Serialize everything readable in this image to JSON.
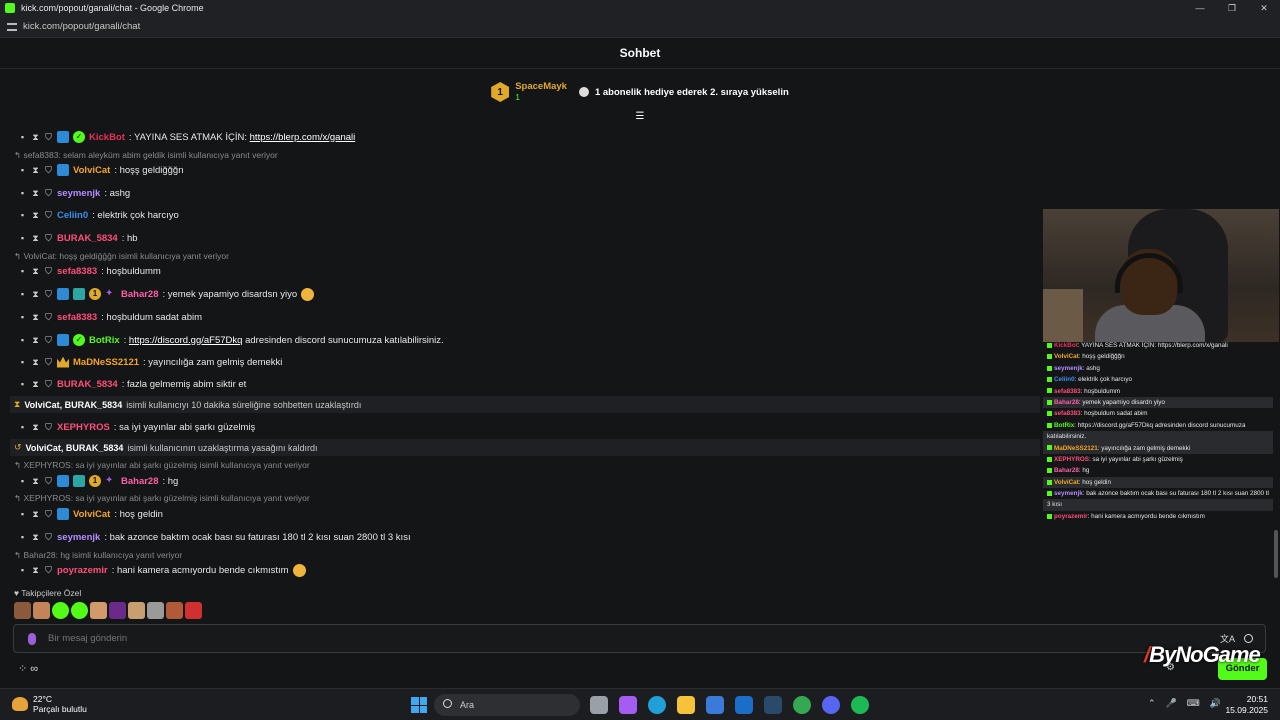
{
  "window": {
    "title": "kick.com/popout/ganali/chat - Google Chrome",
    "url": "kick.com/popout/ganali/chat"
  },
  "header": {
    "title": "Sohbet"
  },
  "pinned": {
    "rank": "1",
    "user": "SpaceMayk",
    "count": "1",
    "text": "1 abonelik hediye ederek 2. sıraya yükselin"
  },
  "messages": [
    {
      "user": "KickBot",
      "color": "#e8315a",
      "text": ": YAYINA SES ATMAK İÇİN: ",
      "link": "https://blerp.com/x/ganali"
    },
    {
      "reply": "sefa8383: selam aleyküm abim geldik isimli kullanıcıya yanıt veriyor",
      "user": "VolviCat",
      "color": "#f5a623",
      "text": ": hoşş geldiğğğn"
    },
    {
      "user": "seymenjk",
      "color": "#b68cff",
      "text": ": ashg"
    },
    {
      "user": "Celiin0",
      "color": "#3a8ef0",
      "text": ": elektrik çok harcıyo"
    },
    {
      "user": "BURAK_5834",
      "color": "#ff4f7a",
      "text": ": hb"
    },
    {
      "reply": "VolviCat: hoşş geldiğğğn isimli kullanıcıya yanıt veriyor",
      "user": "sefa8383",
      "color": "#ff4f7a",
      "text": ": hoşbuldumm"
    },
    {
      "user": "Bahar28",
      "color": "#ff5ea8",
      "text": ": yemek yapamiyo disardsn yiyo"
    },
    {
      "user": "sefa8383",
      "color": "#ff4f7a",
      "text": ": hoşbuldum sadat abim"
    },
    {
      "user": "BotRix",
      "color": "#53fc18",
      "text": " adresinden discord sunucumuza katılabilirsiniz.",
      "link": "https://discord.gg/aF57Dkq",
      "prefix": ": "
    },
    {
      "user": "MaDNeSS2121",
      "color": "#f5a623",
      "text": ": yayıncılığa zam gelmiş demekki"
    },
    {
      "user": "BURAK_5834",
      "color": "#ff4f7a",
      "text": ": fazla gelmemiş abim siktir et"
    },
    {
      "user": "XEPHYROS",
      "color": "#ff4f7a",
      "text": ": sa iyi yayınlar abi şarkı güzelmiş"
    },
    {
      "reply": "XEPHYROS: sa iyi yayınlar abi şarkı güzelmiş isimli kullanıcıya yanıt veriyor",
      "user": "Bahar28",
      "color": "#ff5ea8",
      "text": ": hg"
    },
    {
      "reply": "XEPHYROS: sa iyi yayınlar abi şarkı güzelmiş isimli kullanıcıya yanıt veriyor",
      "user": "VolviCat",
      "color": "#f5a623",
      "text": ": hoş geldin"
    },
    {
      "user": "seymenjk",
      "color": "#b68cff",
      "text": ": bak azonce baktım ocak bası su faturası 180 tl 2 kısı suan 2800 tl 3 kısı"
    },
    {
      "reply": "Bahar28: hg isimli kullanıcıya yanıt veriyor",
      "user": "poyrazemir",
      "color": "#ff4f7a",
      "text": ": hani kamera acmıyordu bende cıkmıstım"
    }
  ],
  "system": [
    {
      "names": "VolviCat, BURAK_5834",
      "text": "isimli kullanıcıyı 10 dakika süreliğine sohbetten uzaklaştırdı"
    },
    {
      "names": "VolviCat, BURAK_5834",
      "text": "isimli kullanıcının uzaklaştırma yasağını kaldırdı"
    }
  ],
  "followers_label": "Takipçilere Özel",
  "input": {
    "placeholder": "Bir mesaj gönderin"
  },
  "send_label": "Gönder",
  "watermark": "ByNoGame",
  "overlay": [
    {
      "u": "KickBot",
      "t": ": YAYINA SES ATMAK İÇİN: https://blerp.com/x/ganali"
    },
    {
      "u": "VolviCat",
      "t": ": hoşş geldiğğğn"
    },
    {
      "u": "seymenjk",
      "t": ": ashg"
    },
    {
      "u": "Celiin0",
      "t": ": elektrik çok harcıyo"
    },
    {
      "u": "sefa8383",
      "t": ": hoşbuldumm"
    },
    {
      "u": "Bahar28",
      "t": ": yemek yapamiyo disardn yiyo"
    },
    {
      "u": "sefa8383",
      "t": ": hoşbuldum sadat abim"
    },
    {
      "u": "BotRix",
      "t": ": https://discord.gg/aF57Dkq adresinden discord sunucumuza"
    },
    {
      "u": "",
      "t": "katılabilirsiniz."
    },
    {
      "u": "MaDNeSS2121",
      "t": ": yayıncılığa zam gelmiş demekki"
    },
    {
      "u": "XEPHYROS",
      "t": ": sa iyi yayınlar abi şarkı güzelmiş"
    },
    {
      "u": "Bahar28",
      "t": ": hg"
    },
    {
      "u": "VolviCat",
      "t": ": hoş geldin"
    },
    {
      "u": "seymenjk",
      "t": ": bak azonce baktım ocak bası su faturası 180 tl 2 kısı suan 2800 tl"
    },
    {
      "u": "",
      "t": "3 kısı"
    },
    {
      "u": "poyrazemir",
      "t": ": hani kamera acmıyordu bende cıkmıstım"
    }
  ],
  "taskbar": {
    "temp": "22°C",
    "weather": "Parçalı bulutlu",
    "search": "Ara",
    "time": "20:51",
    "date": "15.09.2025"
  }
}
